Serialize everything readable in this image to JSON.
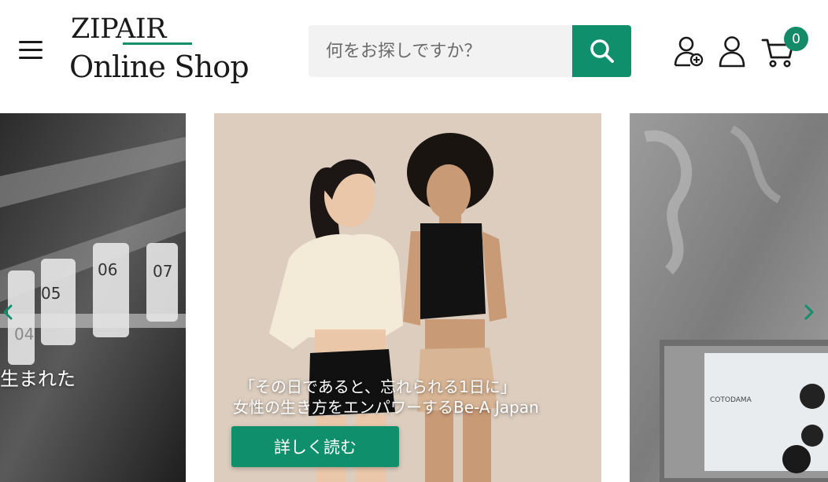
{
  "header": {
    "logo_top": "ZIPAIR",
    "logo_bottom": "Online Shop",
    "search_placeholder": "何をお探しですか？",
    "cart_count": "0"
  },
  "carousel": {
    "slides": [
      {
        "caption": "生まれた"
      },
      {
        "caption_line1": "「その日であると、忘れられる1日に」",
        "caption_line2": "女性の生き方をエンパワーするBe-A Japan",
        "button_label": "詳しく読む"
      },
      {
        "product_brand_text": "COTODAMA"
      }
    ],
    "slide_numbers": [
      "05",
      "06",
      "07",
      "04"
    ]
  },
  "colors": {
    "brand_green": "#0f8f6c",
    "badge_green": "#138a68",
    "text_dark": "#1a1a1a"
  },
  "icons": [
    "menu-icon",
    "search-icon",
    "account-add-icon",
    "account-icon",
    "cart-icon",
    "chevron-left-icon",
    "chevron-right-icon"
  ]
}
